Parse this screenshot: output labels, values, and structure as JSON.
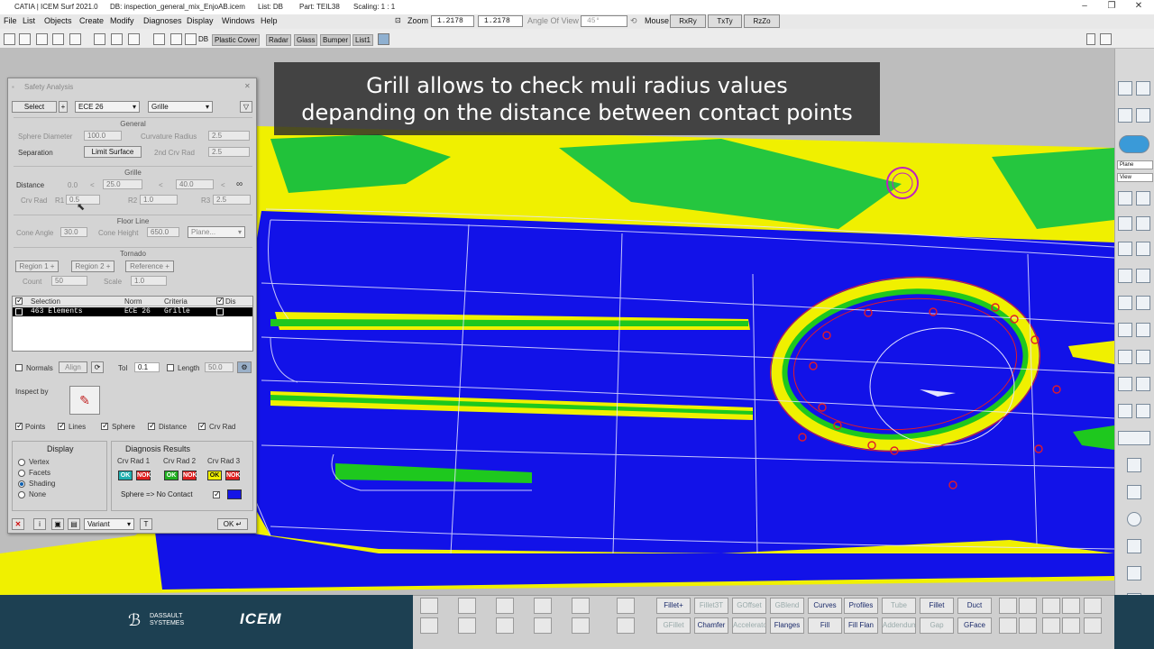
{
  "titlebar": {
    "app": "CATIA | ICEM Surf 2021.0",
    "db": "DB: inspection_general_mix_EnjoAB.icem",
    "list": "List: DB",
    "part": "Part: TEIL38",
    "scaling": "Scaling: 1 : 1"
  },
  "menubar": {
    "items": [
      "File",
      "List",
      "Objects",
      "Create",
      "Modify",
      "Diagnoses",
      "Display",
      "Windows",
      "Help"
    ],
    "zoom_label": "Zoom",
    "zoom_value_1": "1.2178",
    "zoom_value_2": "1.2178",
    "angle_label": "Angle Of View",
    "angle_value": "45°",
    "mouse_label": "Mouse",
    "mouse_buttons": [
      "RxRy",
      "TxTy",
      "RzZo"
    ]
  },
  "toolbar": {
    "db_label": "DB",
    "tabs": [
      "Plastic Cover",
      "Radar",
      "Glass",
      "Bumper",
      "List1"
    ]
  },
  "caption": {
    "line1": "Grill allows to check muli radius values",
    "line2": "depanding on the distance between contact points"
  },
  "dialog": {
    "title": "Safety Analysis",
    "select_label": "Select",
    "norm_value": "ECE 26",
    "criteria_value": "Grille",
    "general": {
      "section": "General",
      "sphere_diameter_label": "Sphere Diameter",
      "sphere_diameter_value": "100.0",
      "curvature_radius_label": "Curvature Radius",
      "curvature_radius_value": "2.5",
      "separation_label": "Separation",
      "limit_surface_label": "Limit Surface",
      "second_crv_rad_label": "2nd Crv Rad",
      "second_crv_rad_value": "2.5"
    },
    "grille": {
      "section": "Grille",
      "distance_label": "Distance",
      "d0": "0.0",
      "lt1": "<",
      "d1": "25.0",
      "lt2": "<",
      "d2": "40.0",
      "lt3": "<",
      "d3": "∞",
      "crv_rad_label": "Crv Rad",
      "r1_label": "R1",
      "r1_value": "0.5",
      "r2_label": "R2",
      "r2_value": "1.0",
      "r3_label": "R3",
      "r3_value": "2.5"
    },
    "floorline": {
      "section": "Floor Line",
      "cone_angle_label": "Cone Angle",
      "cone_angle_value": "30.0",
      "cone_height_label": "Cone Height",
      "cone_height_value": "650.0",
      "plane_value": "Plane..."
    },
    "tornado": {
      "section": "Tornado",
      "region1": "Region 1 +",
      "region2": "Region 2 +",
      "reference": "Reference +",
      "count_label": "Count",
      "count_value": "50",
      "scale_label": "Scale",
      "scale_value": "1.0"
    },
    "table": {
      "headers": [
        "Selection",
        "Norm",
        "Criteria",
        "Dis"
      ],
      "rows": [
        {
          "selection": "463 Elements",
          "norm": "ECE 26",
          "criteria": "Grille"
        }
      ]
    },
    "normals_label": "Normals",
    "align_label": "Align",
    "tol_label": "Tol",
    "tol_value": "0.1",
    "length_label": "Length",
    "length_value": "50.0",
    "inspect_by_label": "Inspect by",
    "checks": [
      "Points",
      "Lines",
      "Sphere",
      "Distance",
      "Crv Rad"
    ],
    "display": {
      "section": "Display",
      "options": [
        "Vertex",
        "Facets",
        "Shading",
        "None"
      ],
      "selected": "Shading"
    },
    "diagnosis": {
      "section": "Diagnosis Results",
      "cols": [
        "Crv Rad 1",
        "Crv Rad 2",
        "Crv Rad 3"
      ],
      "ok": "OK",
      "nok": "NOK",
      "sphere_label": "Sphere => No Contact"
    },
    "variant_value": "Variant",
    "ok_label": "OK"
  },
  "right_panel": {
    "plane_value": "Plane",
    "view_value": "View"
  },
  "bottom": {
    "brand1": "DASSAULT SYSTEMES",
    "brand2": "ICEM",
    "row1": [
      "Fillet+",
      "Fillet3T",
      "GOffset",
      "GBlend",
      "Curves",
      "Profiles",
      "Tube",
      "Fillet",
      "Duct"
    ],
    "row2": [
      "GFillet",
      "Chamfer",
      "Accelerator",
      "Flanges",
      "Fill",
      "Fill Flan",
      "Addendum",
      "Gap",
      "GFace"
    ]
  },
  "colors": {
    "surface_blue": "#1515e6",
    "surface_yellow": "#f5f500",
    "surface_green": "#1ec81e",
    "wire_white": "#e6e6ff",
    "marker_red": "#e01a2a",
    "marker_magenta": "#c020c0",
    "bottom_bg": "#1d4052"
  }
}
